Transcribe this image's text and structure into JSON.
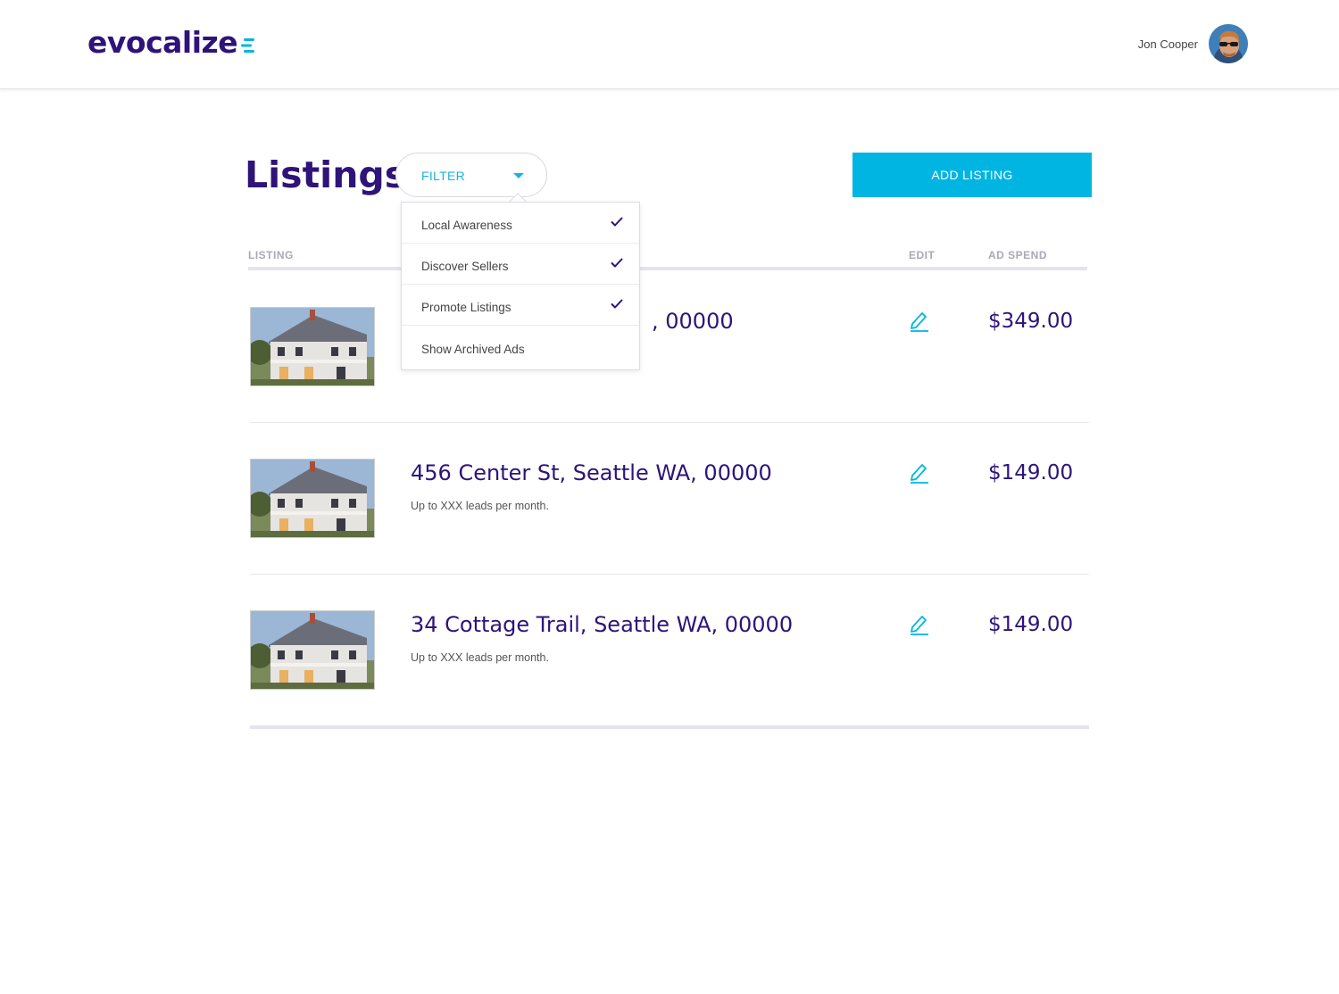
{
  "header": {
    "logo_text": "evocalize",
    "user_name": "Jon Cooper"
  },
  "page": {
    "title": "Listings:",
    "filter_label": "FILTER",
    "add_button_label": "ADD LISTING"
  },
  "table": {
    "columns": {
      "listing": "LISTING",
      "edit": "EDIT",
      "ad_spend": "AD SPEND"
    },
    "rows": [
      {
        "address": ", 00000",
        "subtitle": "",
        "ad_spend": "$349.00"
      },
      {
        "address": "456 Center St, Seattle WA, 00000",
        "subtitle": "Up to XXX leads per month.",
        "ad_spend": "$149.00"
      },
      {
        "address": "34 Cottage Trail, Seattle WA, 00000",
        "subtitle": "Up to XXX leads per month.",
        "ad_spend": "$149.00"
      }
    ]
  },
  "filter_menu": {
    "items": [
      {
        "label": "Local Awareness",
        "checked": true
      },
      {
        "label": "Discover Sellers",
        "checked": true
      },
      {
        "label": "Promote Listings",
        "checked": true
      },
      {
        "label": "Show Archived Ads",
        "checked": false
      }
    ]
  },
  "colors": {
    "brand_purple": "#2e1479",
    "accent_cyan": "#00b5e2"
  }
}
